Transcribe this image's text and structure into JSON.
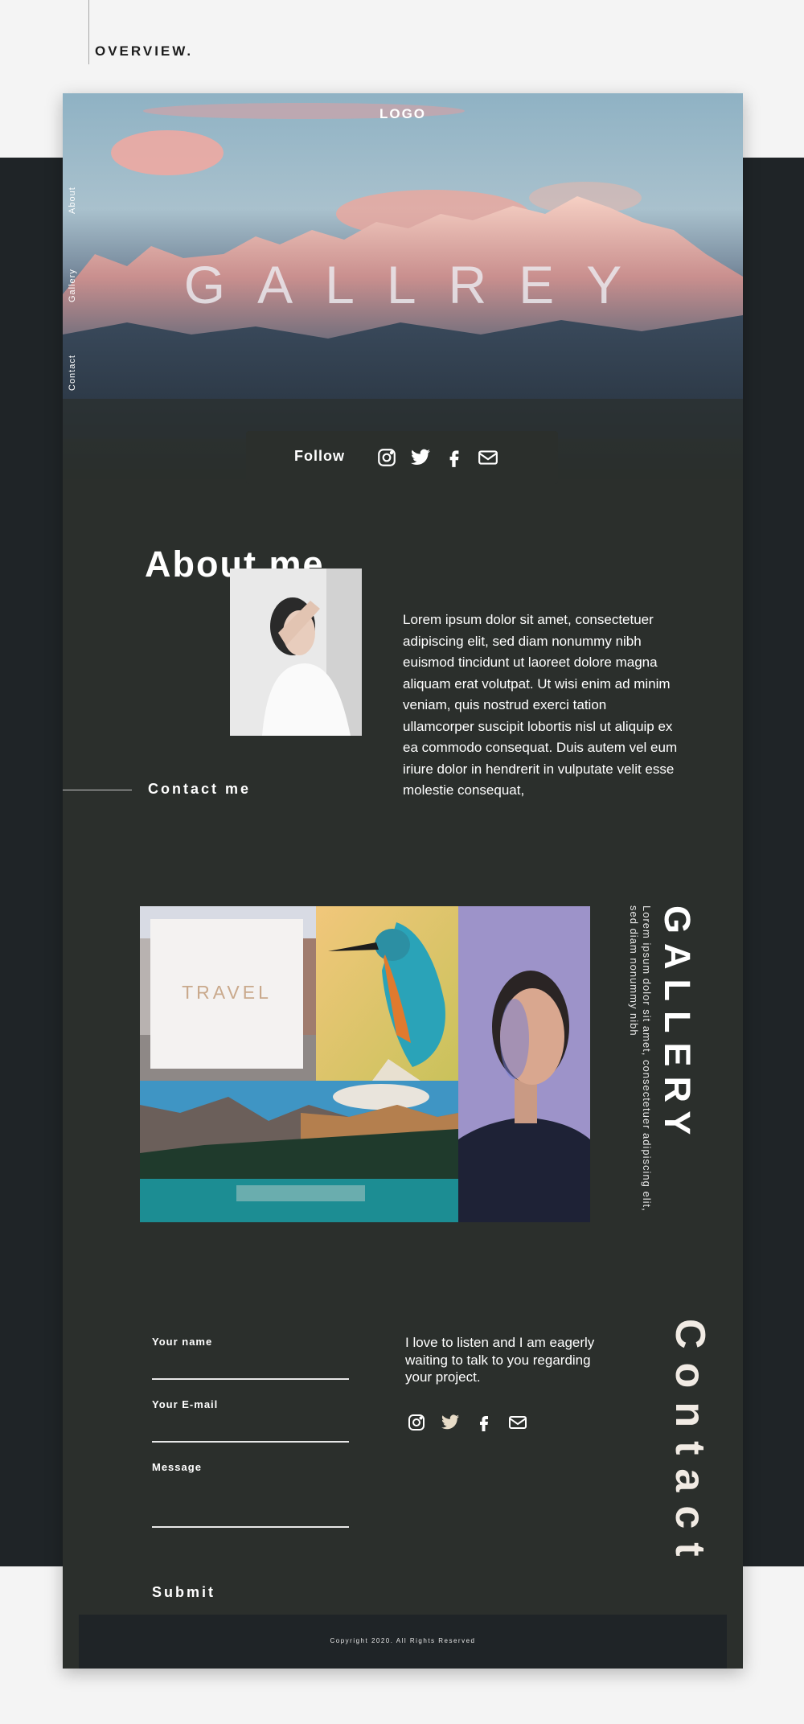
{
  "page": {
    "heading": "OVERVIEW."
  },
  "hero": {
    "logo": "LOGO",
    "title": "GALLREY",
    "side_nav": [
      "About",
      "Gallery",
      "Contact"
    ],
    "follow_label": "Follow",
    "social_icons": [
      "instagram-icon",
      "twitter-icon",
      "facebook-icon",
      "mail-icon"
    ]
  },
  "about": {
    "title": "About me",
    "text": "Lorem ipsum dolor sit amet, consectetuer adipiscing elit, sed diam nonummy nibh euismod tincidunt ut laoreet dolore magna aliquam erat volutpat. Ut wisi enim ad minim veniam, quis nostrud exerci tation ullamcorper suscipit lobortis nisl ut aliquip ex ea commodo consequat. Duis autem vel eum iriure dolor in hendrerit in vulputate velit esse molestie consequat,",
    "contact_link": "Contact me"
  },
  "gallery": {
    "travel_label": "TRAVEL",
    "side_title": "GALLERY",
    "side_text": "Lorem ipsum dolor sit amet, consectetuer adipiscing elit, sed diam nonummy nibh"
  },
  "contact": {
    "name_label": "Your name",
    "email_label": "Your E-mail",
    "message_label": "Message",
    "submit": "Submit",
    "text": "I love to listen and I am eagerly waiting to talk to you regarding your project.",
    "side_title": "Contact"
  },
  "footer": {
    "copyright": "Copyright 2020. All Rights Reserved"
  },
  "colors": {
    "page_bg": "#f4f4f4",
    "dark_band": "#1f2427",
    "site_bg": "#2b2f2c",
    "travel_accent": "#c9a98c",
    "contact_title": "#f1ebe4"
  }
}
